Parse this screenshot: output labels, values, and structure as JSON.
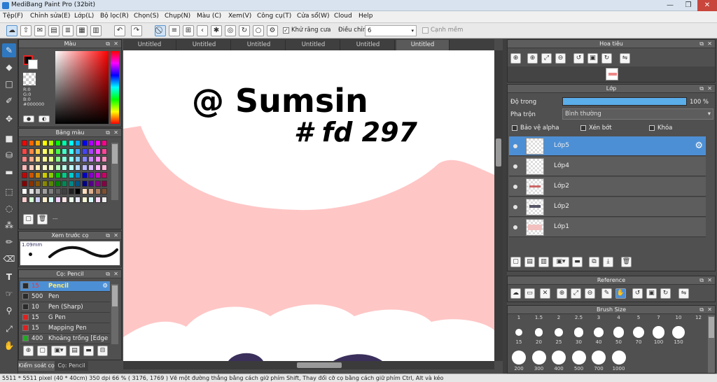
{
  "window": {
    "title": "MediBang Paint Pro (32bit)",
    "minimize": "—",
    "maximize": "❐",
    "close": "✕"
  },
  "menu": [
    "Tệp(F)",
    "Chỉnh sửa(E)",
    "Lớp(L)",
    "Bộ lọc(R)",
    "Chọn(S)",
    "Chụp(N)",
    "Màu (C)",
    "Xem(V)",
    "Công cụ(T)",
    "Cửa sổ(W)",
    "Cloud",
    "Help"
  ],
  "toolbar": {
    "antialias_label": "Khử răng cưa",
    "adjust_label": "Điều chỉnh",
    "adjust_value": "6",
    "smooth_label": "Cạnh mềm"
  },
  "color_panel": {
    "title": "Màu",
    "r": "R:0",
    "g": "G:0",
    "b": "B:0",
    "hex": "#000000"
  },
  "palette_panel": {
    "title": "Bảng màu",
    "dots": "---"
  },
  "brush_preview": {
    "title": "Xem trước cọ",
    "size": "1.09mm"
  },
  "brush_panel": {
    "title": "Cọ: Pencil",
    "brushes": [
      {
        "size": "15",
        "name": "Pencil",
        "color": "#2a2a2a"
      },
      {
        "size": "500",
        "name": "Pen",
        "color": "#2a2a2a"
      },
      {
        "size": "10",
        "name": "Pen (Sharp)",
        "color": "#2a2a2a"
      },
      {
        "size": "15",
        "name": "G Pen",
        "color": "#e02020"
      },
      {
        "size": "15",
        "name": "Mapping Pen",
        "color": "#e02020"
      },
      {
        "size": "400",
        "name": "Khoảng trống [Edge",
        "color": "#22aa22"
      }
    ]
  },
  "bottom_tabs": {
    "left": "Kiểm soát cọ",
    "right": "Cọ: Pencil"
  },
  "tabs": [
    "Untitled",
    "Untitled",
    "Untitled",
    "Untitled",
    "Untitled",
    "Untitled"
  ],
  "canvas_text": {
    "line1": "@ Sumsin",
    "line2": "# fd 297"
  },
  "navigator": {
    "title": "Hoa tiêu"
  },
  "layer_panel": {
    "title": "Lớp",
    "opacity_label": "Độ trong",
    "opacity_value": "100 %",
    "opacity": 1.0,
    "blend_label": "Pha trộn",
    "blend_value": "Bình thường",
    "protect_alpha": "Bảo vệ alpha",
    "clip": "Xén bớt",
    "lock": "Khóa",
    "layers": [
      "Lớp5",
      "Lớp4",
      "Lớp2",
      "Lớp2",
      "Lớp1"
    ]
  },
  "reference_panel": {
    "title": "Reference"
  },
  "brush_size_panel": {
    "title": "Brush Size",
    "top_labels": [
      "1",
      "1.5",
      "2",
      "2.5",
      "3",
      "4",
      "5",
      "7",
      "10",
      "12"
    ],
    "sizes_row1": [
      "15",
      "20",
      "25",
      "30",
      "40",
      "50",
      "70",
      "100",
      "150"
    ],
    "sizes_row2": [
      "200",
      "300",
      "400",
      "500",
      "700",
      "1000"
    ]
  },
  "status": "5511 * 5511 pixel   (40 * 40cm)   350 dpi   66 %   ( 3176, 1769 )   Vẽ một đường thẳng bằng cách giữ phím Shift, Thay đổi cỡ cọ bằng cách giữ phím Ctrl, Alt và kéo"
}
